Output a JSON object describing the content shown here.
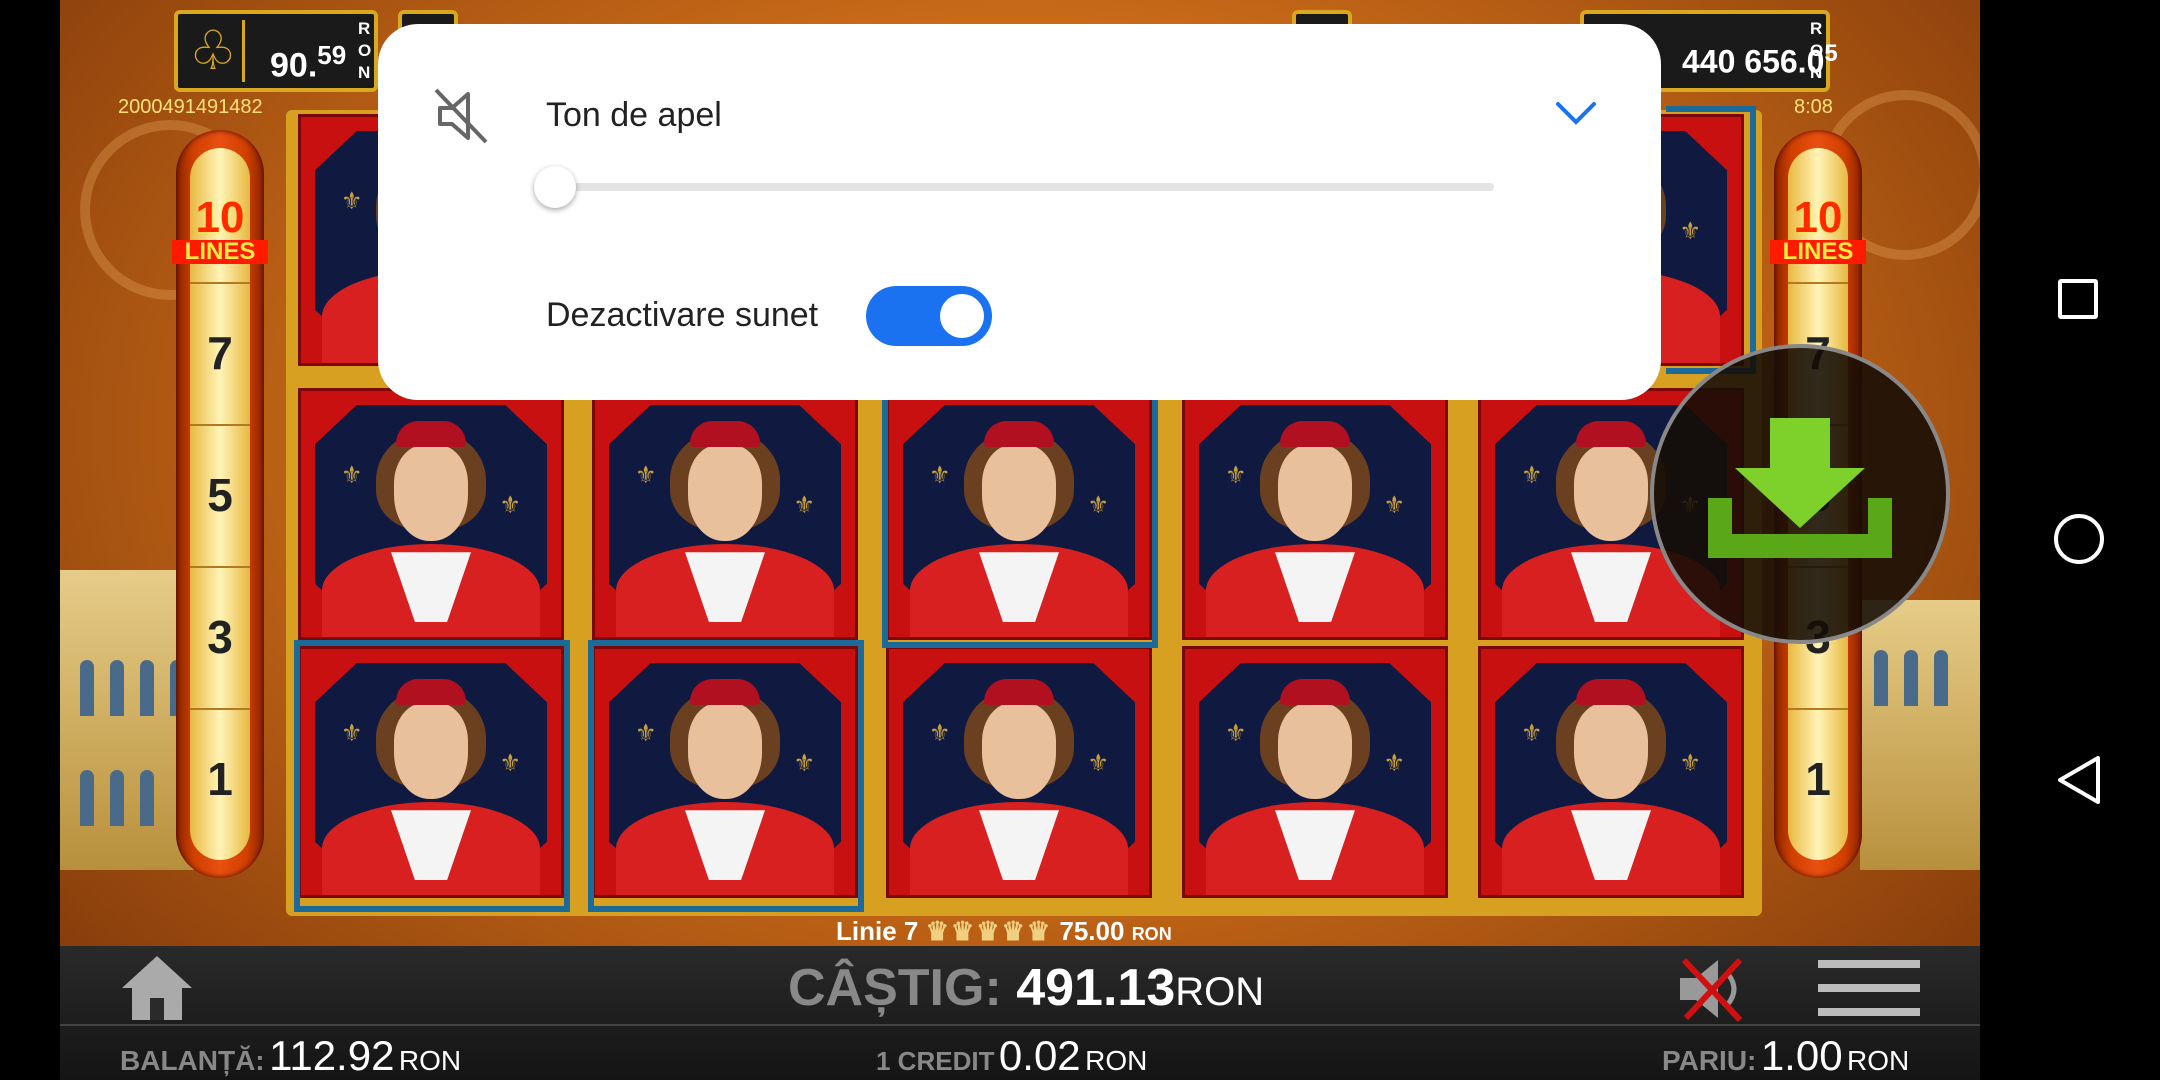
{
  "counters": {
    "left": {
      "icon": "club-icon",
      "value_main": "90.",
      "value_sup": "59",
      "currency": "RON"
    },
    "right": {
      "value_main": "440 656.0",
      "value_sup": "5",
      "currency": "RON"
    }
  },
  "ticket_id": "2000491491482",
  "clock": "8:08",
  "side_bars": {
    "lines_count": "10",
    "lines_label": "LINES",
    "numbers": [
      "7",
      "5",
      "3",
      "1"
    ]
  },
  "win_line": {
    "label": "Linie 7",
    "amount": "75.00",
    "currency": "RON"
  },
  "bottom": {
    "win_label": "CÂȘTIG:",
    "win_value": "491.13",
    "win_currency": "RON",
    "balance_label": "BALANȚĂ:",
    "balance_value": "112.92",
    "balance_currency": "RON",
    "credit_label": "1 CREDIT",
    "credit_value": "0.02",
    "credit_currency": "RON",
    "bet_label": "PARIU:",
    "bet_value": "1.00",
    "bet_currency": "RON"
  },
  "dialog": {
    "ringtone_label": "Ton de apel",
    "ringtone_level": 0,
    "mute_label": "Dezactivare sunet",
    "mute_on": true
  },
  "colors": {
    "accent": "#1a72f0",
    "win_frame": "#1c6a9a",
    "gold": "#d8a820"
  },
  "icons": [
    "club-icon",
    "speaker-muted-icon",
    "chevron-down-icon",
    "home-icon",
    "sound-off-icon",
    "menu-icon",
    "download-icon",
    "nav-square-icon",
    "nav-circle-icon",
    "nav-back-icon"
  ]
}
